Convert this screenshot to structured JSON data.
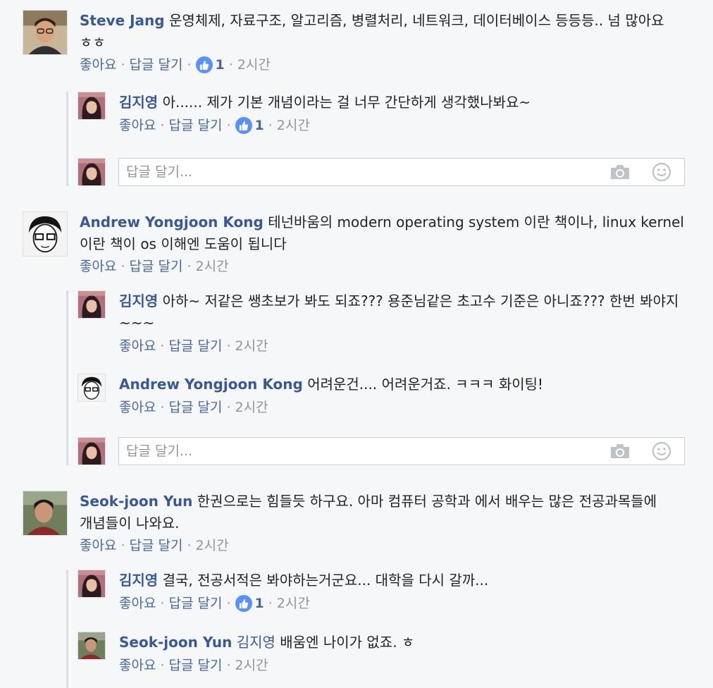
{
  "labels": {
    "like": "좋아요",
    "reply": "답글 달기",
    "reply_placeholder": "답글 달기..."
  },
  "colors": {
    "link": "#385898",
    "like_badge": "#5890ff",
    "meta": "#90949c"
  },
  "threads": [
    {
      "comment": {
        "author": "Steve Jang",
        "text": "운영체제, 자료구조, 알고리즘, 병렬처리, 네트워크, 데이터베이스 등등등.. 넘 많아요 ㅎㅎ",
        "likes": "1",
        "time": "2시간"
      },
      "replies": [
        {
          "author": "김지영",
          "text": "아...... 제가 기본 개념이라는 걸 너무 간단하게 생각했나봐요~",
          "likes": "1",
          "time": "2시간"
        }
      ]
    },
    {
      "comment": {
        "author": "Andrew Yongjoon Kong",
        "text": "테넌바움의 modern operating system 이란 책이나, linux kernel 이란 책이 os 이해엔 도움이 됩니다",
        "time": "2시간"
      },
      "replies": [
        {
          "author": "김지영",
          "text": "아하~ 저같은 쌩초보가 봐도 되죠??? 용준님같은 초고수 기준은 아니죠??? 한번 봐야지~~~",
          "time": "2시간"
        },
        {
          "author": "Andrew Yongjoon Kong",
          "text": "어려운건.... 어려운거죠. ㅋㅋㅋ 화이팅!",
          "time": "2시간"
        }
      ]
    },
    {
      "comment": {
        "author": "Seok-joon Yun",
        "text": "한권으로는 힘들듯 하구요. 아마 컴퓨터 공학과 에서 배우는 많은 전공과목들에 개념들이 나와요.",
        "time": "2시간"
      },
      "replies": [
        {
          "author": "김지영",
          "text": "결국, 전공서적은 봐야하는거군요... 대학을 다시 갈까...",
          "likes": "1",
          "time": "2시간"
        },
        {
          "author": "Seok-joon Yun",
          "mention": "김지영",
          "text": "배움엔 나이가 없죠. ㅎ",
          "time": "2시간"
        }
      ]
    }
  ]
}
